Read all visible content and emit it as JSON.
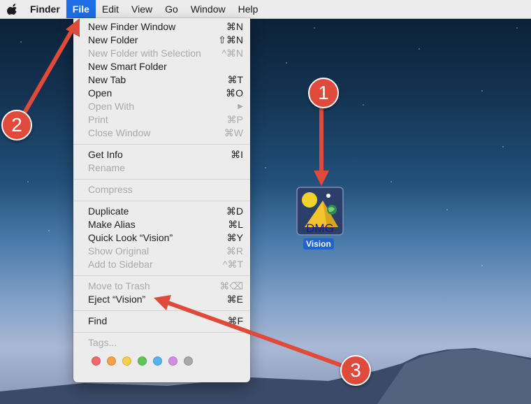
{
  "menubar": {
    "items": [
      {
        "label": "Finder"
      },
      {
        "label": "File"
      },
      {
        "label": "Edit"
      },
      {
        "label": "View"
      },
      {
        "label": "Go"
      },
      {
        "label": "Window"
      },
      {
        "label": "Help"
      }
    ]
  },
  "file_menu": {
    "items": [
      {
        "label": "New Finder Window",
        "shortcut": "⌘N",
        "enabled": true
      },
      {
        "label": "New Folder",
        "shortcut": "⇧⌘N",
        "enabled": true
      },
      {
        "label": "New Folder with Selection",
        "shortcut": "^⌘N",
        "enabled": false
      },
      {
        "label": "New Smart Folder",
        "shortcut": "",
        "enabled": true
      },
      {
        "label": "New Tab",
        "shortcut": "⌘T",
        "enabled": true
      },
      {
        "label": "Open",
        "shortcut": "⌘O",
        "enabled": true
      },
      {
        "label": "Open With",
        "shortcut": "▶",
        "enabled": false
      },
      {
        "label": "Print",
        "shortcut": "⌘P",
        "enabled": false
      },
      {
        "label": "Close Window",
        "shortcut": "⌘W",
        "enabled": false
      },
      {
        "label": "Get Info",
        "shortcut": "⌘I",
        "enabled": true
      },
      {
        "label": "Rename",
        "shortcut": "",
        "enabled": false
      },
      {
        "label": "Compress",
        "shortcut": "",
        "enabled": false
      },
      {
        "label": "Duplicate",
        "shortcut": "⌘D",
        "enabled": true
      },
      {
        "label": "Make Alias",
        "shortcut": "⌘L",
        "enabled": true
      },
      {
        "label": "Quick Look “Vision”",
        "shortcut": "⌘Y",
        "enabled": true
      },
      {
        "label": "Show Original",
        "shortcut": "⌘R",
        "enabled": false
      },
      {
        "label": "Add to Sidebar",
        "shortcut": "^⌘T",
        "enabled": false
      },
      {
        "label": "Move to Trash",
        "shortcut": "⌘⌫",
        "enabled": false
      },
      {
        "label": "Eject “Vision”",
        "shortcut": "⌘E",
        "enabled": true
      },
      {
        "label": "Find",
        "shortcut": "⌘F",
        "enabled": true
      },
      {
        "label": "Tags...",
        "shortcut": "",
        "enabled": false
      }
    ],
    "tag_colors": [
      "#f0686a",
      "#f5a04a",
      "#f4cf47",
      "#5fc659",
      "#56b3ec",
      "#d38be3",
      "#a8a8a8"
    ]
  },
  "desktop": {
    "file": {
      "label": "Vision",
      "icon_text": "DMG",
      "icon": "dmg-disk-image-icon"
    }
  },
  "callouts": {
    "one": "1",
    "two": "2",
    "three": "3"
  },
  "colors": {
    "accent": "#1d6ee6",
    "callout": "#e04a3b",
    "selection": "#1f63d1"
  }
}
